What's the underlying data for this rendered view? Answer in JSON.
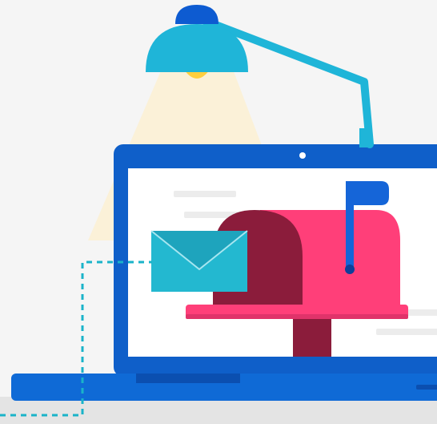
{
  "illustration": {
    "subject": "desk-lamp-laptop-mailbox",
    "icons": [
      "lamp-icon",
      "laptop-icon",
      "mailbox-icon",
      "envelope-icon",
      "flag-icon",
      "dashed-path"
    ],
    "colors": {
      "background": "#f5f5f5",
      "desk": "#e4e4e4",
      "lamp_body": "#1fb5d8",
      "lamp_cap": "#0d5bd1",
      "lamp_bulb": "#ffcf3f",
      "light_beam": "#fbf0d2",
      "laptop_frame": "#0f5fc9",
      "laptop_base": "#0f6ad6",
      "laptop_screen": "#ffffff",
      "mailbox_pink": "#ff3f79",
      "mailbox_dark": "#8b1c3b",
      "flag_blue": "#1565d8",
      "envelope_teal": "#23b8d0",
      "dashes": "#1ab3c9"
    }
  }
}
